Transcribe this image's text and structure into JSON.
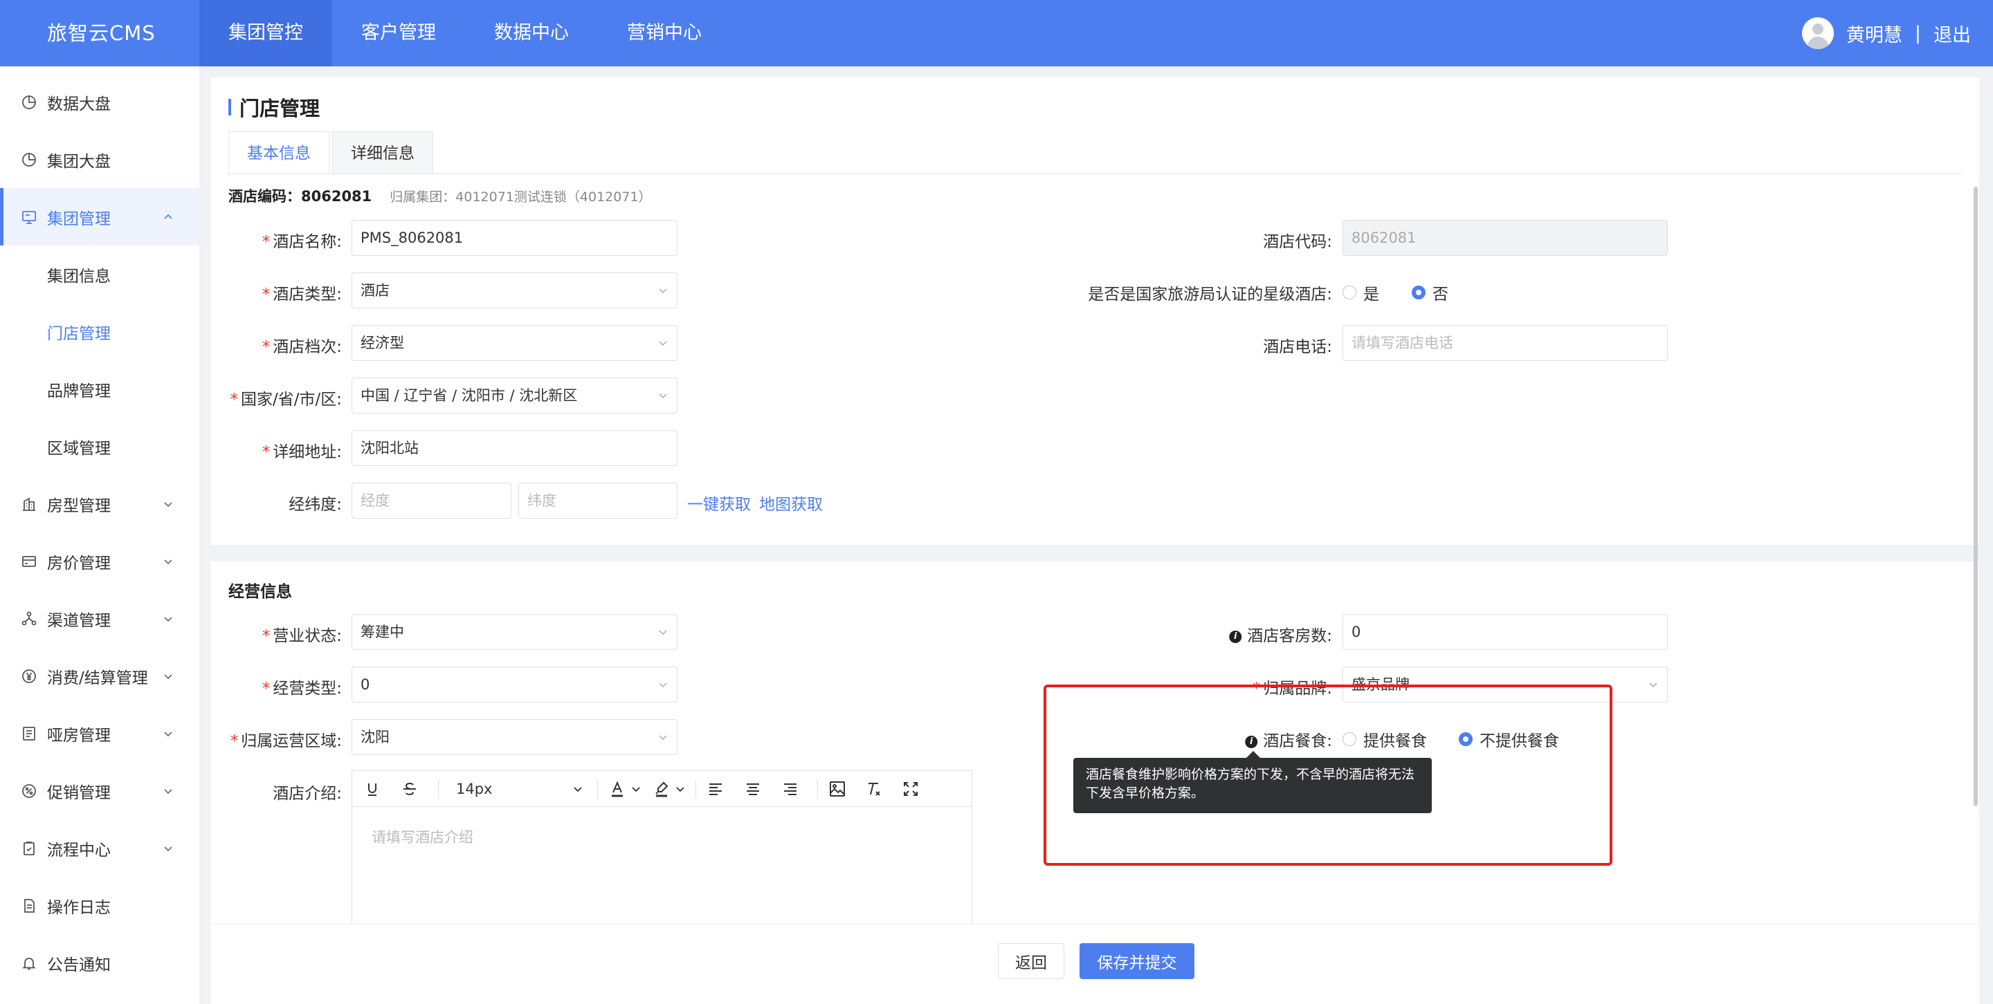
{
  "app": {
    "brand": "旅智云CMS"
  },
  "topnav": [
    "集团管控",
    "客户管理",
    "数据中心",
    "营销中心"
  ],
  "user": {
    "name": "黄明慧",
    "separator": "|",
    "logout": "退出"
  },
  "sidebar": {
    "items": [
      {
        "label": "数据大盘",
        "icon": "pie-chart-icon"
      },
      {
        "label": "集团大盘",
        "icon": "pie-chart-icon"
      },
      {
        "label": "集团管理",
        "icon": "monitor-icon",
        "expanded": true
      },
      {
        "label": "集团信息"
      },
      {
        "label": "门店管理",
        "active": true
      },
      {
        "label": "品牌管理"
      },
      {
        "label": "区域管理"
      },
      {
        "label": "房型管理",
        "icon": "building-icon"
      },
      {
        "label": "房价管理",
        "icon": "card-icon"
      },
      {
        "label": "渠道管理",
        "icon": "network-icon"
      },
      {
        "label": "消费/结算管理",
        "icon": "yen-icon"
      },
      {
        "label": "哑房管理",
        "icon": "list-doc-icon"
      },
      {
        "label": "促销管理",
        "icon": "promo-icon"
      },
      {
        "label": "流程中心",
        "icon": "clipboard-icon"
      },
      {
        "label": "操作日志",
        "icon": "document-icon"
      },
      {
        "label": "公告通知",
        "icon": "bell-icon"
      }
    ]
  },
  "page": {
    "title": "门店管理",
    "tabs": [
      "基本信息",
      "详细信息"
    ],
    "hotel_code_label": "酒店编码：",
    "hotel_code": "8062081",
    "group_info": "归属集团：4012071测试连锁（4012071）"
  },
  "basic": {
    "name": {
      "label": "酒店名称:",
      "value": "PMS_8062081"
    },
    "type": {
      "label": "酒店类型:",
      "value": "酒店"
    },
    "grade": {
      "label": "酒店档次:",
      "value": "经济型"
    },
    "region": {
      "label": "国家/省/市/区:",
      "value": "中国 / 辽宁省 / 沈阳市 / 沈北新区"
    },
    "address": {
      "label": "详细地址:",
      "value": "沈阳北站"
    },
    "coords": {
      "label": "经纬度:",
      "lng_placeholder": "经度",
      "lat_placeholder": "纬度",
      "auto_get": "一键获取",
      "map_get": "地图获取"
    },
    "hotel_code_field": {
      "label": "酒店代码:",
      "value": "8062081"
    },
    "star_certified": {
      "label": "是否是国家旅游局认证的星级酒店:",
      "options": [
        "是",
        "否"
      ],
      "selected": "否"
    },
    "phone": {
      "label": "酒店电话:",
      "placeholder": "请填写酒店电话"
    }
  },
  "business": {
    "section_title": "经营信息",
    "status": {
      "label": "营业状态:",
      "value": "筹建中"
    },
    "op_type": {
      "label": "经营类型:",
      "value": "0"
    },
    "op_region": {
      "label": "归属运营区域:",
      "value": "沈阳"
    },
    "intro": {
      "label": "酒店介绍:",
      "placeholder": "请填写酒店介绍",
      "font_size": "14px"
    },
    "rooms": {
      "label": "酒店客房数:",
      "value": "0"
    },
    "brand": {
      "label": "归属品牌:",
      "value": "盛京品牌"
    },
    "dining": {
      "label": "酒店餐食:",
      "options": [
        "提供餐食",
        "不提供餐食"
      ],
      "selected": "不提供餐食"
    },
    "dining_tooltip": [
      "酒店餐食维护影响价格方案的下发，不含早的酒店将无法",
      "下发含早价格方案。"
    ]
  },
  "footer": {
    "back": "返回",
    "submit": "保存并提交"
  },
  "colors": {
    "primary": "#4d7ef0",
    "highlight": "#e8201d",
    "required": "#e53935"
  }
}
